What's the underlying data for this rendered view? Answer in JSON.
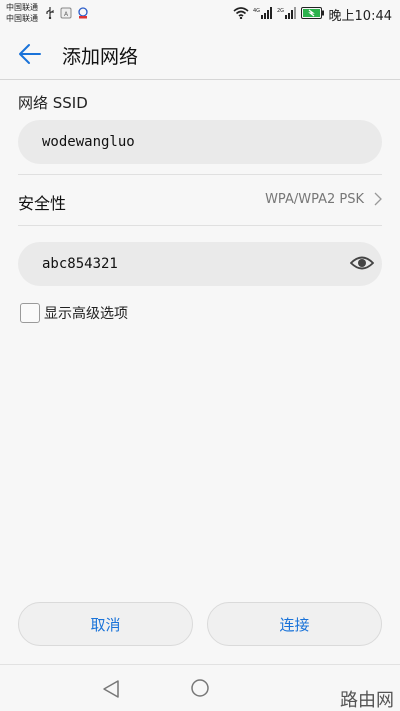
{
  "status_bar": {
    "carrier_1": "中国联通",
    "carrier_2": "中国联通",
    "network_1": "4G",
    "network_2": "2G",
    "time": "晚上10:44"
  },
  "app_bar": {
    "title": "添加网络"
  },
  "form": {
    "ssid_label": "网络 SSID",
    "ssid_value": "wodewangluo",
    "security_label": "安全性",
    "security_value": "WPA/WPA2 PSK",
    "password_value": "abc854321",
    "advanced_label": "显示高级选项",
    "advanced_checked": false
  },
  "buttons": {
    "cancel": "取消",
    "connect": "连接"
  },
  "watermark": "路由网",
  "colors": {
    "accent": "#1a73d9",
    "background": "#f7f7f7",
    "input_bg": "#eaeaea"
  }
}
